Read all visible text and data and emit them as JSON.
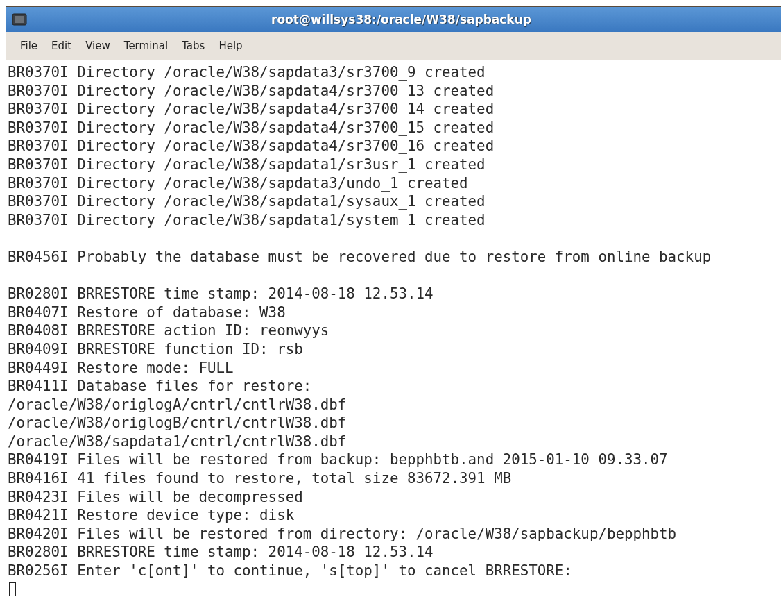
{
  "window": {
    "title": "root@willsys38:/oracle/W38/sapbackup"
  },
  "menu": [
    {
      "label": "File"
    },
    {
      "label": "Edit"
    },
    {
      "label": "View"
    },
    {
      "label": "Terminal"
    },
    {
      "label": "Tabs"
    },
    {
      "label": "Help"
    }
  ],
  "terminal": {
    "lines": [
      {
        "kind": "output",
        "text": "BR0370I Directory /oracle/W38/sapdata3/sr3700_9 created"
      },
      {
        "kind": "output",
        "text": "BR0370I Directory /oracle/W38/sapdata4/sr3700_13 created"
      },
      {
        "kind": "output",
        "text": "BR0370I Directory /oracle/W38/sapdata4/sr3700_14 created"
      },
      {
        "kind": "output",
        "text": "BR0370I Directory /oracle/W38/sapdata4/sr3700_15 created"
      },
      {
        "kind": "output",
        "text": "BR0370I Directory /oracle/W38/sapdata4/sr3700_16 created"
      },
      {
        "kind": "output",
        "text": "BR0370I Directory /oracle/W38/sapdata1/sr3usr_1 created"
      },
      {
        "kind": "output",
        "text": "BR0370I Directory /oracle/W38/sapdata3/undo_1 created"
      },
      {
        "kind": "output",
        "text": "BR0370I Directory /oracle/W38/sapdata1/sysaux_1 created"
      },
      {
        "kind": "output",
        "text": "BR0370I Directory /oracle/W38/sapdata1/system_1 created"
      },
      {
        "kind": "blank"
      },
      {
        "kind": "output",
        "text": "BR0456I Probably the database must be recovered due to restore from online backup"
      },
      {
        "kind": "blank"
      },
      {
        "kind": "output",
        "text": "BR0280I BRRESTORE time stamp: 2014-08-18 12.53.14"
      },
      {
        "kind": "output",
        "text": "BR0407I Restore of database: W38"
      },
      {
        "kind": "output",
        "text": "BR0408I BRRESTORE action ID: reonwyys"
      },
      {
        "kind": "output",
        "text": "BR0409I BRRESTORE function ID: rsb"
      },
      {
        "kind": "output",
        "text": "BR0449I Restore mode: FULL"
      },
      {
        "kind": "output",
        "text": "BR0411I Database files for restore:"
      },
      {
        "kind": "output",
        "text": "/oracle/W38/origlogA/cntrl/cntlrW38.dbf"
      },
      {
        "kind": "output",
        "text": "/oracle/W38/origlogB/cntrl/cntrlW38.dbf"
      },
      {
        "kind": "output",
        "text": "/oracle/W38/sapdata1/cntrl/cntrlW38.dbf"
      },
      {
        "kind": "output",
        "text": "BR0419I Files will be restored from backup: bepphbtb.and 2015-01-10 09.33.07"
      },
      {
        "kind": "output",
        "text": "BR0416I 41 files found to restore, total size 83672.391 MB"
      },
      {
        "kind": "output",
        "text": "BR0423I Files will be decompressed"
      },
      {
        "kind": "output",
        "text": "BR0421I Restore device type: disk"
      },
      {
        "kind": "output",
        "text": "BR0420I Files will be restored from directory: /oracle/W38/sapbackup/bepphbtb"
      },
      {
        "kind": "output",
        "text": "BR0280I BRRESTORE time stamp: 2014-08-18 12.53.14"
      },
      {
        "kind": "output",
        "text": "BR0256I Enter 'c[ont]' to continue, 's[top]' to cancel BRRESTORE:"
      },
      {
        "kind": "cursor"
      }
    ]
  }
}
